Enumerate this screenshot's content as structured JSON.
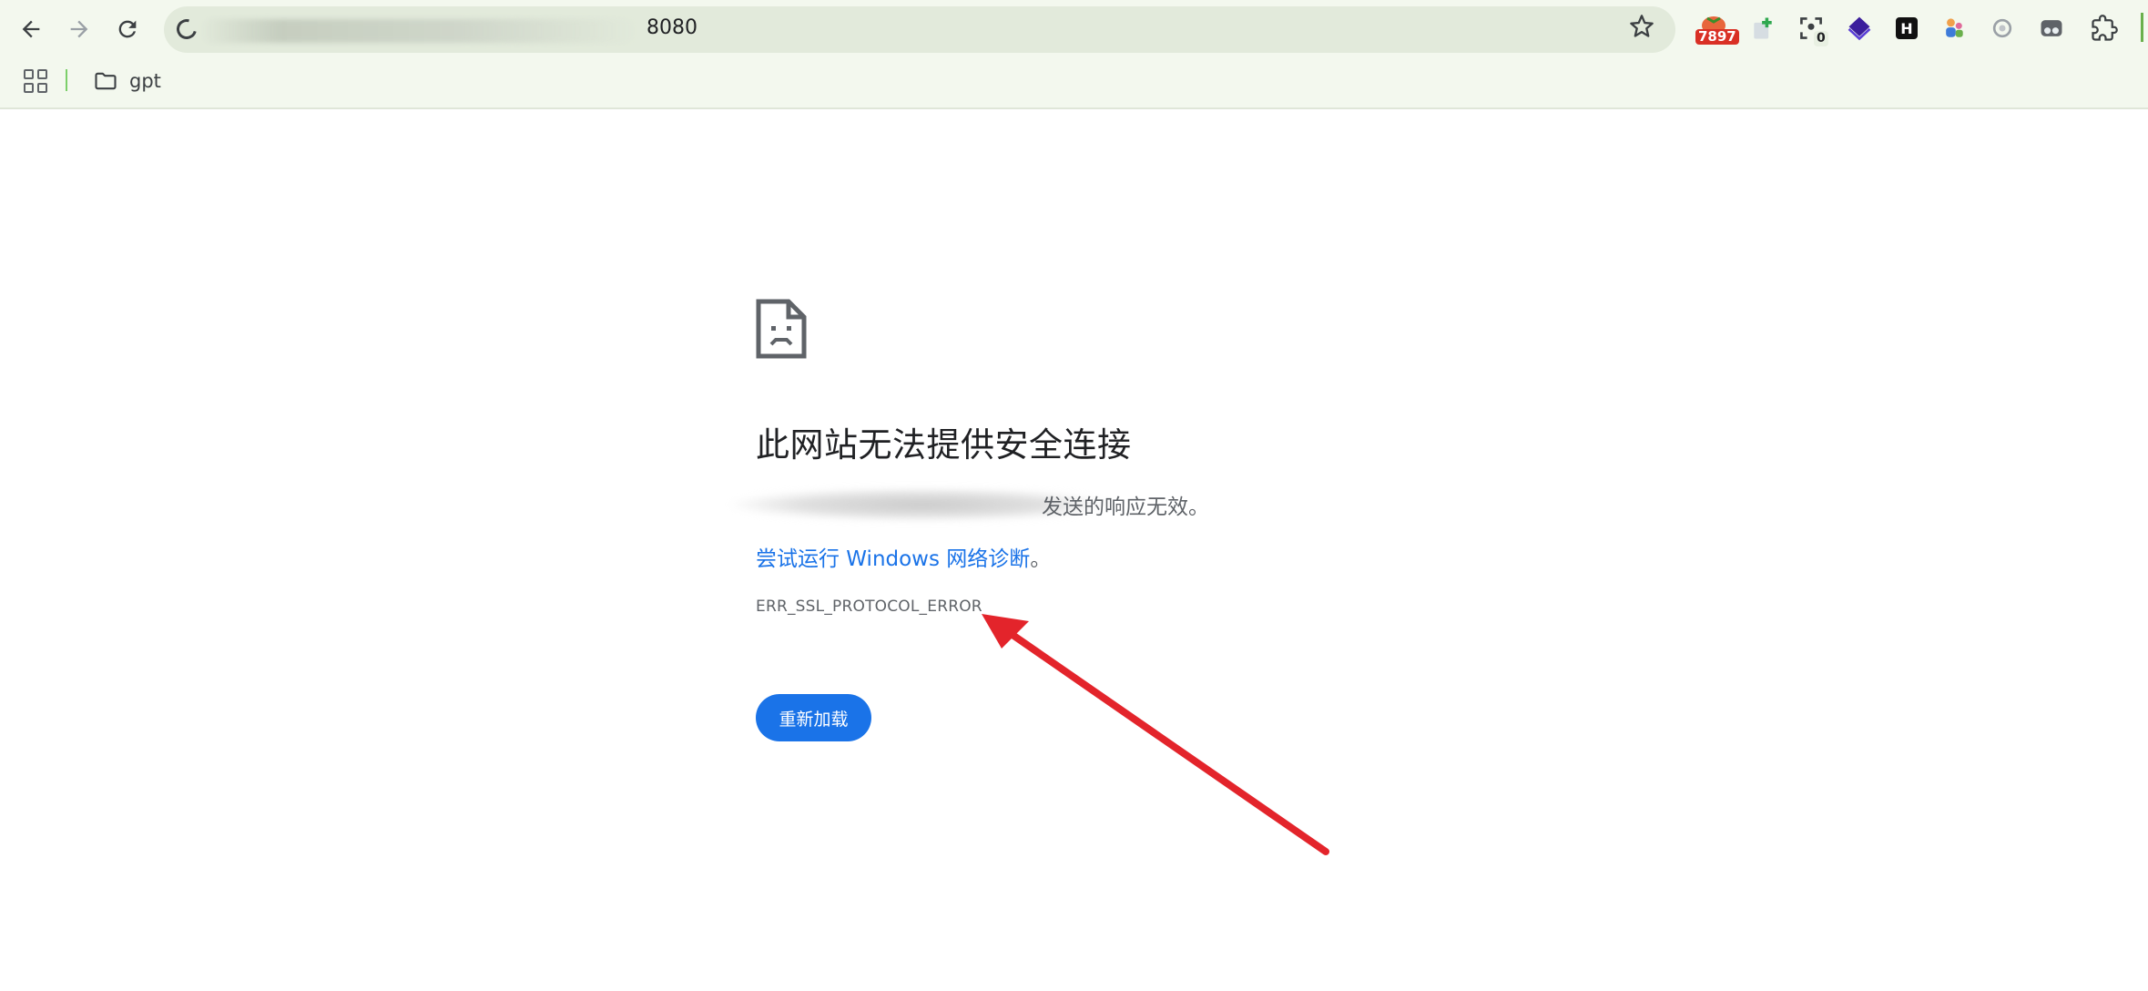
{
  "browser": {
    "url_suffix": "8080",
    "extensions": [
      {
        "name": "tomato-extension-icon",
        "badge": "7897"
      },
      {
        "name": "green-plus-extension-icon",
        "badge": ""
      },
      {
        "name": "capture-extension-icon",
        "badge": "0"
      },
      {
        "name": "purple-diamond-extension-icon",
        "badge": ""
      },
      {
        "name": "h-logo-extension-icon",
        "badge": "",
        "label": "H"
      },
      {
        "name": "people-extension-icon",
        "badge": ""
      },
      {
        "name": "gray-circle-extension-icon",
        "badge": ""
      },
      {
        "name": "glasses-extension-icon",
        "badge": ""
      },
      {
        "name": "puzzle-extensions-icon",
        "badge": ""
      }
    ],
    "bookmarks": [
      {
        "label": "gpt"
      }
    ]
  },
  "error_page": {
    "title": "此网站无法提供安全连接",
    "description_suffix": "发送的响应无效。",
    "suggestion_prefix": "尝试运行 ",
    "suggestion_link": "尝试运行 Windows 网络诊断",
    "suggestion_end": "。",
    "error_code": "ERR_SSL_PROTOCOL_ERROR",
    "reload_label": "重新加载"
  },
  "colors": {
    "chrome_bg": "#f3f8ee",
    "omnibox_bg": "#e2eadb",
    "link_blue": "#1a73e8",
    "button_blue": "#1a73e8",
    "annotation_arrow": "#e3242b"
  }
}
